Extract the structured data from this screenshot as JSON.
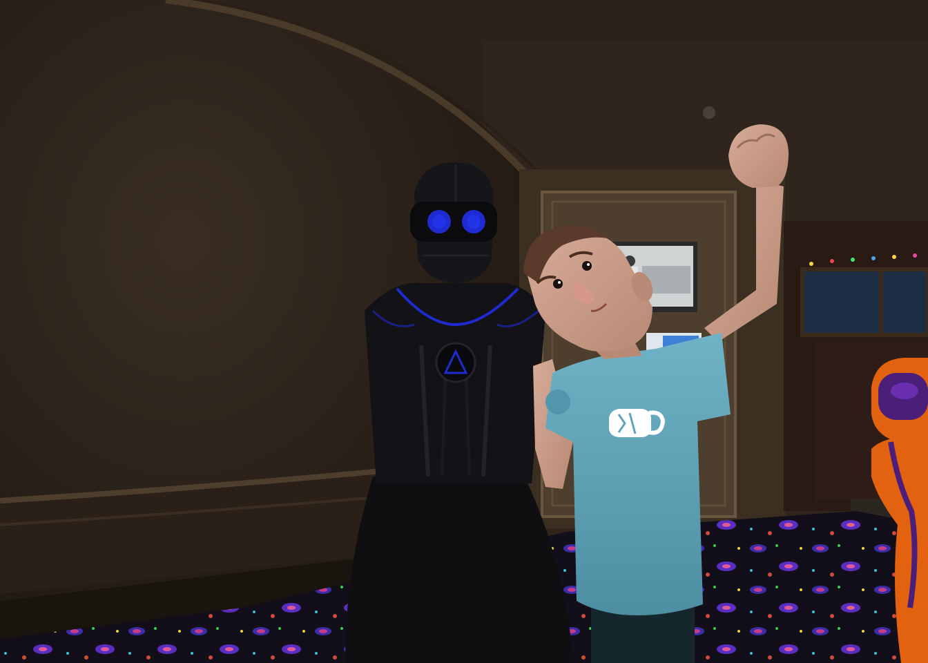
{
  "scene": {
    "colors": {
      "wall": "#34291f",
      "wall_dark": "#241c15",
      "ceiling": "#2b2219",
      "trim": "#4a3a2a",
      "carpet": "#14101c",
      "door": "#5a4a37",
      "window_sky": "#1c2d44",
      "robot_body": "#0f0f12",
      "robot_accent": "#1f2bd1",
      "person_skin": "#c89a86",
      "person_shirt": "#5ea3b8",
      "person_hair": "#5a3a2a",
      "orange_robot": "#e2620f",
      "orange_robot_face": "#4b1e7a"
    },
    "icons": {
      "shirt_logo": "vr-headset-icon",
      "robot_chest": "triangle-icon"
    }
  }
}
